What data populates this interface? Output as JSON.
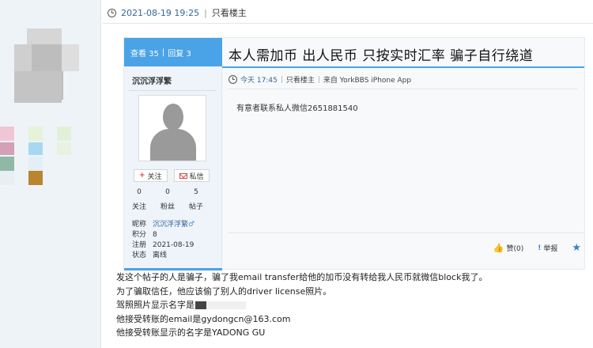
{
  "outer_meta": {
    "datetime": "2021-08-19  19:25",
    "separator": "|",
    "only_op": "只看楼主"
  },
  "embed": {
    "stats": {
      "views": "查看 35",
      "separator": "|",
      "replies": "回复 3"
    },
    "author": {
      "name": "沉沉浮浮繁",
      "follow_label": "关注",
      "message_label": "私信",
      "counts": [
        {
          "value": "0",
          "label": "关注"
        },
        {
          "value": "0",
          "label": "粉丝"
        },
        {
          "value": "5",
          "label": "帖子"
        }
      ],
      "profile": [
        {
          "key": "昵称",
          "value": "沉沉浮浮繁"
        },
        {
          "key": "积分",
          "value": "8"
        },
        {
          "key": "注册",
          "value": "2021-08-19"
        },
        {
          "key": "状态",
          "value": "离线"
        }
      ]
    },
    "title": "本人需加币 出人民币 只按实时汇率 骗子自行绕道",
    "meta": {
      "time": "今天 17:45",
      "separator": "|",
      "only_op": "只看楼主",
      "source": "来自 YorkBBS iPhone App"
    },
    "body": "有意者联系私人微信2651881540",
    "actions": {
      "like": "赞(0)",
      "report": "举报"
    }
  },
  "post_body": {
    "line1": "发这个帖子的人是骗子，骗了我email transfer给他的加币没有转给我人民币就微信block我了。",
    "line2": "为了骗取信任，他应该偷了别人的driver license照片。",
    "line3_prefix": "驾照照片显示名字是",
    "line4": "他接受转账的email是gydongcn@163.com",
    "line5": "他接受转账显示的名字是YADONG GU"
  },
  "colors": {
    "accent_blue": "#4aa3e6",
    "link_blue": "#336699",
    "sidebar_bg": "#eef3f8"
  }
}
